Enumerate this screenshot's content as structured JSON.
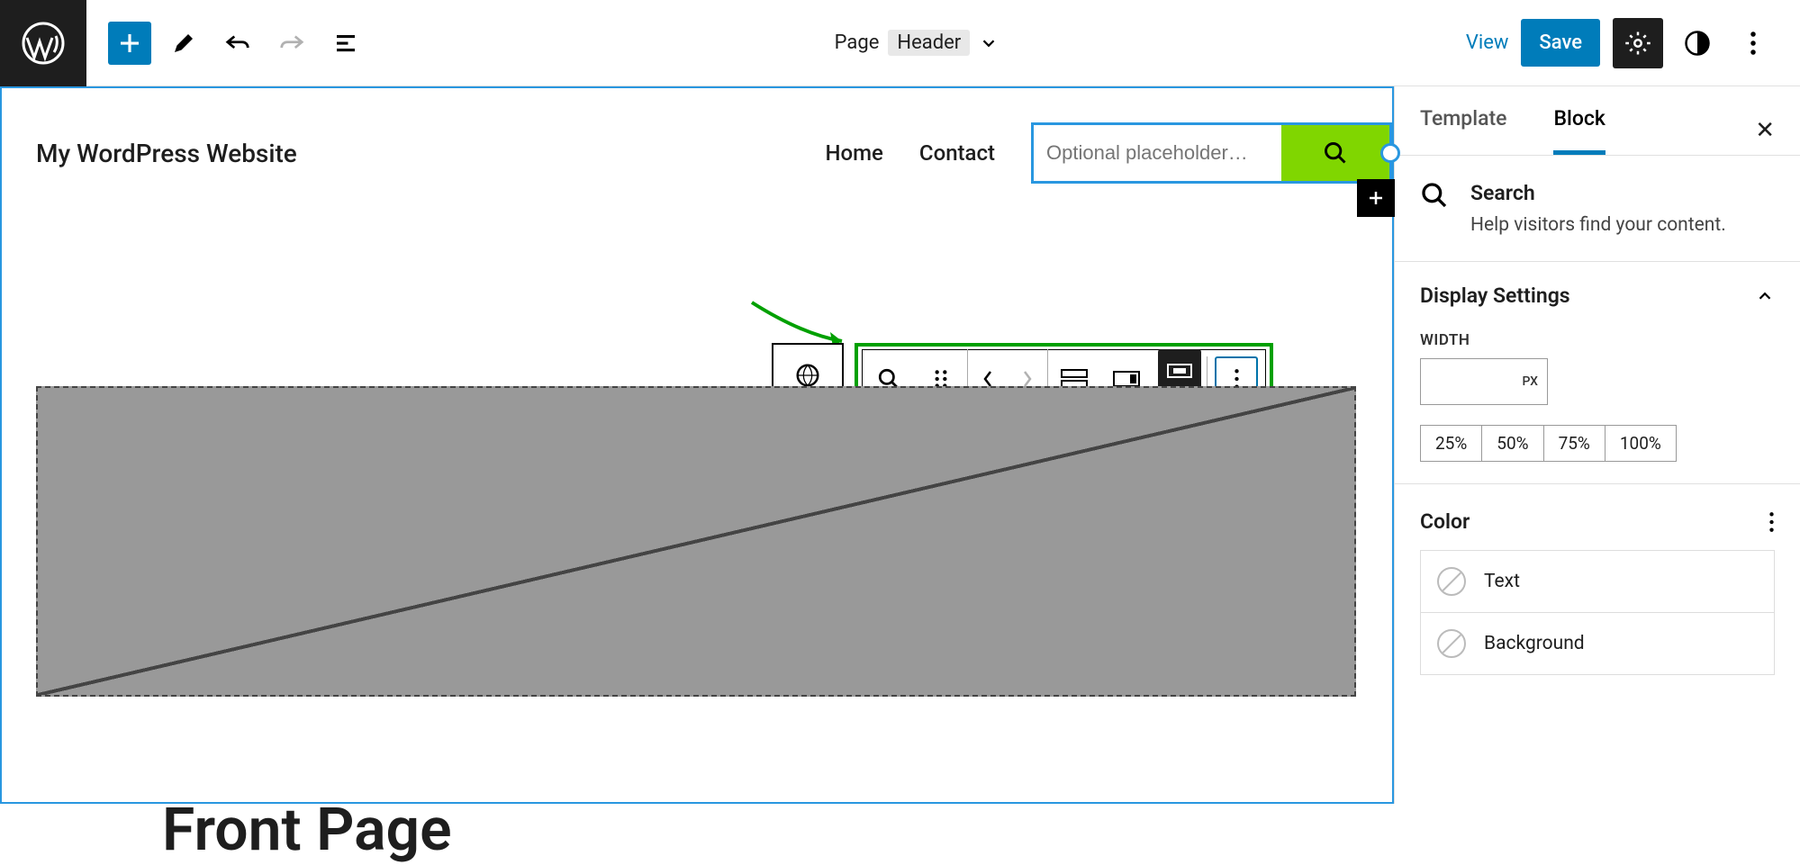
{
  "topbar": {
    "center_label": "Page",
    "center_badge": "Header",
    "view_label": "View",
    "save_label": "Save"
  },
  "header": {
    "site_title": "My WordPress Website",
    "nav": [
      "Home",
      "Contact"
    ],
    "search_placeholder": "Optional placeholder…"
  },
  "page_title": "Front Page",
  "sidebar": {
    "tabs": {
      "template": "Template",
      "block": "Block"
    },
    "block": {
      "name": "Search",
      "desc": "Help visitors find your content."
    },
    "panels": {
      "display": {
        "title": "Display Settings",
        "width_label": "WIDTH",
        "unit": "PX",
        "presets": [
          "25%",
          "50%",
          "75%",
          "100%"
        ]
      },
      "color": {
        "title": "Color",
        "rows": [
          "Text",
          "Background"
        ]
      }
    }
  }
}
